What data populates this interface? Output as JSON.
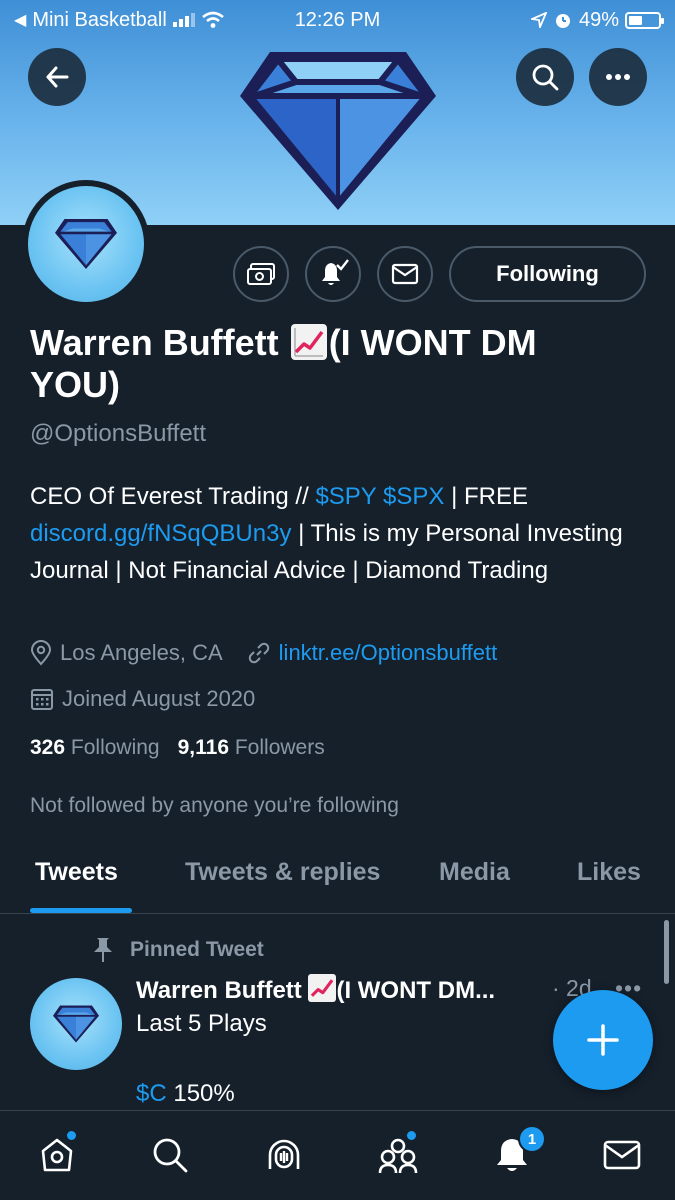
{
  "status_bar": {
    "carrier": "Mini Basketball",
    "time": "12:26 PM",
    "battery": "49%"
  },
  "header": {
    "back_icon": "arrow-left-icon",
    "search_icon": "search-icon",
    "more_icon": "more-horizontal-icon"
  },
  "profile": {
    "name_part1": "Warren Buffett",
    "name_part2": "(I WONT DM YOU)",
    "handle": "@OptionsBuffett",
    "bio": {
      "t1": "CEO Of Everest Trading // ",
      "l1": "$SPY",
      "t2": " ",
      "l2": "$SPX",
      "t3": " | FREE ",
      "l3": "discord.gg/fNSqQBUn3y",
      "t4": " | This is my Personal Investing Journal | Not Financial Advice | Diamond Trading"
    },
    "location": "Los Angeles, CA",
    "website": "linktr.ee/Optionsbuffett",
    "joined": "Joined August 2020",
    "following_count": "326",
    "following_label": "Following",
    "followers_count": "9,116",
    "followers_label": "Followers",
    "not_followed": "Not followed by anyone you’re following"
  },
  "actions": {
    "following_button": "Following",
    "tip_icon": "money-icon",
    "notify_icon": "bell-check-icon",
    "message_icon": "envelope-icon"
  },
  "tabs": [
    {
      "label": "Tweets",
      "active": true
    },
    {
      "label": "Tweets & replies",
      "active": false
    },
    {
      "label": "Media",
      "active": false
    },
    {
      "label": "Likes",
      "active": false
    }
  ],
  "pinned_tweet": {
    "pinned_label": "Pinned Tweet",
    "author": "Warren Buffett",
    "author_suffix": "(I WONT DM...",
    "time": "· 2d",
    "more": "•••",
    "text_line1": "Last 5 Plays",
    "ticker": "$C",
    "ticker_value": " 150%"
  },
  "bottom_nav": {
    "home_icon": "home-icon",
    "search_icon": "search-icon",
    "spaces_icon": "spaces-icon",
    "communities_icon": "communities-icon",
    "notifications_icon": "bell-icon",
    "notifications_badge": "1",
    "messages_icon": "envelope-icon"
  },
  "colors": {
    "background": "#15202b",
    "accent": "#1d9bf0",
    "muted": "#8b98a5",
    "border": "#38444d"
  }
}
